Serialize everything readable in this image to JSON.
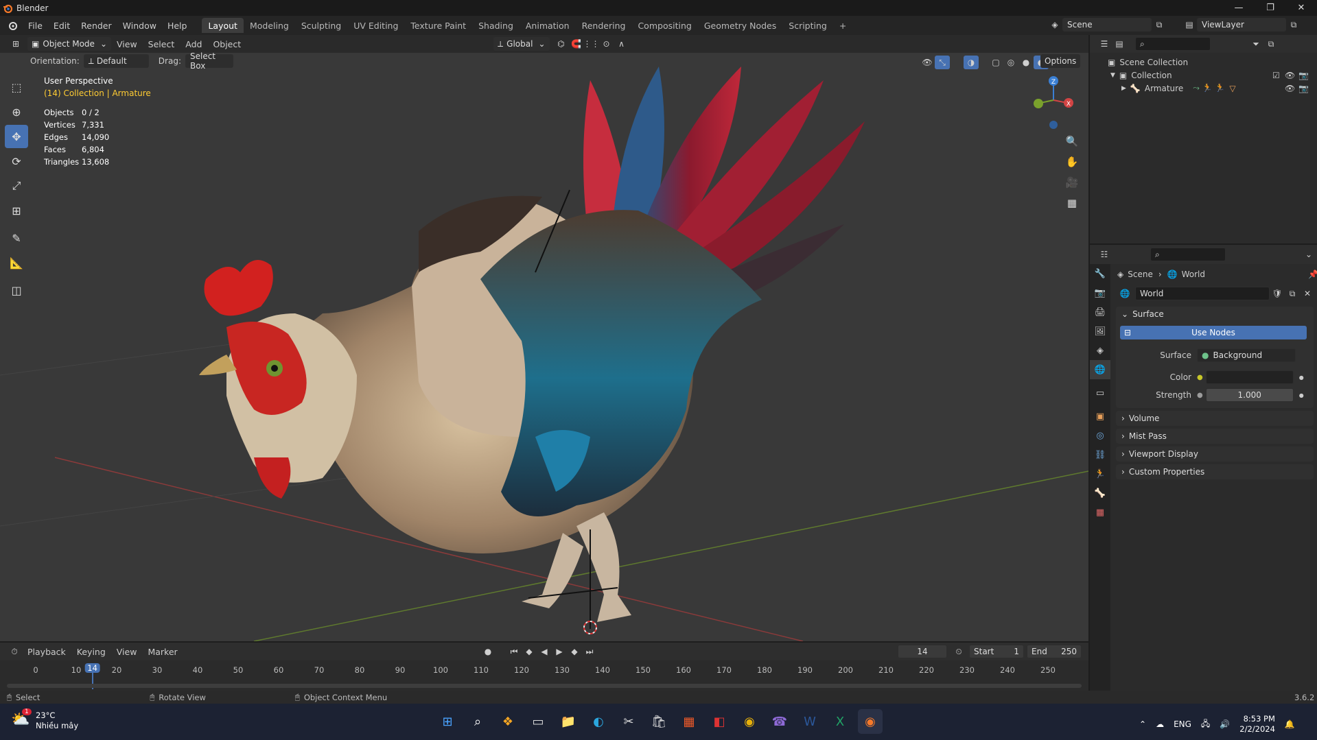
{
  "window": {
    "title": "Blender"
  },
  "menu": [
    "File",
    "Edit",
    "Render",
    "Window",
    "Help"
  ],
  "workspaces": [
    {
      "label": "Layout",
      "active": true
    },
    {
      "label": "Modeling"
    },
    {
      "label": "Sculpting"
    },
    {
      "label": "UV Editing"
    },
    {
      "label": "Texture Paint"
    },
    {
      "label": "Shading"
    },
    {
      "label": "Animation"
    },
    {
      "label": "Rendering"
    },
    {
      "label": "Compositing"
    },
    {
      "label": "Geometry Nodes"
    },
    {
      "label": "Scripting"
    }
  ],
  "scene_field": "Scene",
  "viewlayer_field": "ViewLayer",
  "viewport": {
    "mode": "Object Mode",
    "header_menu": [
      "View",
      "Select",
      "Add",
      "Object"
    ],
    "transform": "Global",
    "orientation_label": "Orientation:",
    "orientation_value": "Default",
    "drag_label": "Drag:",
    "drag_value": "Select Box",
    "options": "Options",
    "perspective": "User Perspective",
    "collection_info": "(14) Collection | Armature",
    "stats": [
      {
        "label": "Objects",
        "value": "0 / 2"
      },
      {
        "label": "Vertices",
        "value": "7,331"
      },
      {
        "label": "Edges",
        "value": "14,090"
      },
      {
        "label": "Faces",
        "value": "6,804"
      },
      {
        "label": "Triangles",
        "value": "13,608"
      }
    ],
    "gizmo": {
      "z": "Z",
      "x": "X"
    }
  },
  "outliner": {
    "scene_collection": "Scene Collection",
    "collection": "Collection",
    "armature": "Armature"
  },
  "properties": {
    "breadcrumb_scene": "Scene",
    "breadcrumb_world": "World",
    "world_name": "World",
    "surface_panel": "Surface",
    "use_nodes": "Use Nodes",
    "surface_label": "Surface",
    "surface_value": "Background",
    "color_label": "Color",
    "strength_label": "Strength",
    "strength_value": "1.000",
    "panels": [
      "Volume",
      "Mist Pass",
      "Viewport Display",
      "Custom Properties"
    ]
  },
  "timeline": {
    "menu": [
      "Playback",
      "Keying",
      "View",
      "Marker"
    ],
    "current_frame": "14",
    "start_label": "Start",
    "start": "1",
    "end_label": "End",
    "end": "250",
    "ruler": [
      "0",
      "10",
      "20",
      "30",
      "40",
      "50",
      "60",
      "70",
      "80",
      "90",
      "100",
      "110",
      "120",
      "130",
      "140",
      "150",
      "160",
      "170",
      "180",
      "190",
      "200",
      "210",
      "220",
      "230",
      "240",
      "250"
    ],
    "playhead": "14"
  },
  "status": {
    "select": "Select",
    "rotate": "Rotate View",
    "context": "Object Context Menu",
    "version": "3.6.2"
  },
  "taskbar": {
    "weather_temp": "23°C",
    "weather_desc": "Nhiều mây",
    "lang": "ENG",
    "time": "8:53 PM",
    "date": "2/2/2024",
    "badge": "1"
  },
  "colors": {
    "accent": "#4772b3",
    "selection": "#ffaf29",
    "axis_x": "#d24444",
    "axis_y": "#7aa12c",
    "axis_z": "#3a7fd4"
  }
}
